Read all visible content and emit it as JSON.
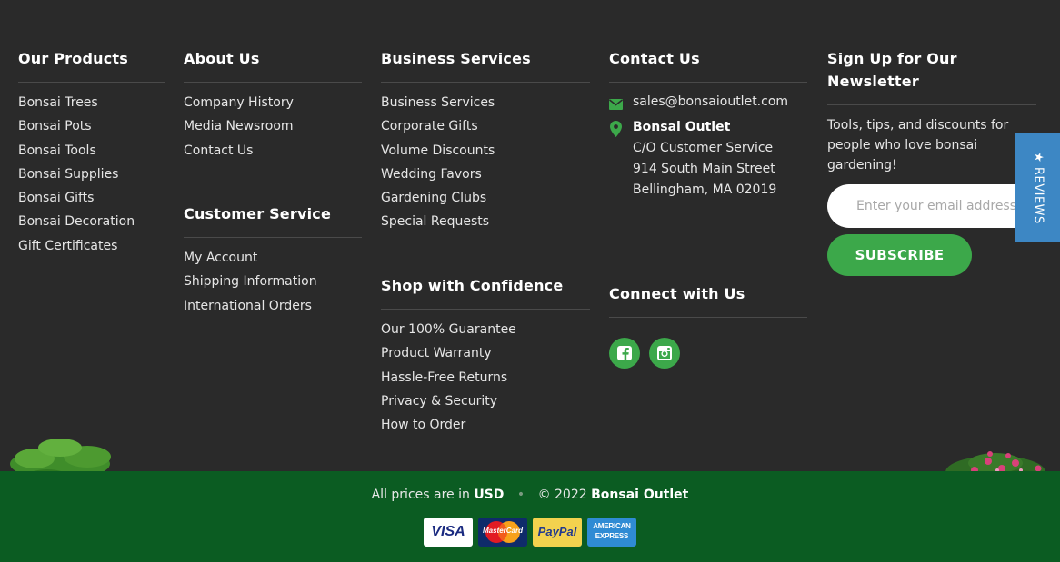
{
  "columns": {
    "products": {
      "heading": "Our Products",
      "links": [
        "Bonsai Trees",
        "Bonsai Pots",
        "Bonsai Tools",
        "Bonsai Supplies",
        "Bonsai Gifts",
        "Bonsai Decoration",
        "Gift Certificates"
      ]
    },
    "about": {
      "heading": "About Us",
      "links": [
        "Company History",
        "Media Newsroom",
        "Contact Us"
      ]
    },
    "customer_service": {
      "heading": "Customer Service",
      "links": [
        "My Account",
        "Shipping Information",
        "International Orders"
      ]
    },
    "business": {
      "heading": "Business Services",
      "links": [
        "Business Services",
        "Corporate Gifts",
        "Volume Discounts",
        "Wedding Favors",
        "Gardening Clubs",
        "Special Requests"
      ]
    },
    "confidence": {
      "heading": "Shop with Confidence",
      "links": [
        "Our 100% Guarantee",
        "Product Warranty",
        "Hassle-Free Returns",
        "Privacy & Security",
        "How to Order"
      ]
    }
  },
  "contact": {
    "heading": "Contact Us",
    "email": "sales@bonsaioutlet.com",
    "company": "Bonsai Outlet",
    "address_line1": "C/O Customer Service",
    "address_line2": "914 South Main Street",
    "address_line3": "Bellingham, MA 02019"
  },
  "connect": {
    "heading": "Connect with Us",
    "networks": [
      "facebook-icon",
      "instagram-icon"
    ]
  },
  "newsletter": {
    "heading_line1": "Sign Up for Our",
    "heading_line2": "Newsletter",
    "text": "Tools, tips, and discounts for people who love bonsai gardening!",
    "placeholder": "Enter your email address...",
    "button_label": "SUBSCRIBE"
  },
  "reviews_tab": {
    "label": "★ REVIEWS"
  },
  "bottom_bar": {
    "prices_prefix": "All prices are in",
    "currency": "USD",
    "copyright_prefix": "© 2022",
    "brand": "Bonsai Outlet",
    "payment_cards": [
      {
        "label": "VISA"
      },
      {
        "label": "MasterCard"
      },
      {
        "label": "PayPal"
      },
      {
        "label_line1": "AMERICAN",
        "label_line2": "EXPRESS"
      }
    ]
  },
  "colors": {
    "footer_bg": "#2a2a2a",
    "bottom_bar_bg": "#0b5c22",
    "accent_green": "#3ca84a",
    "reviews_blue": "#3d87c4"
  }
}
